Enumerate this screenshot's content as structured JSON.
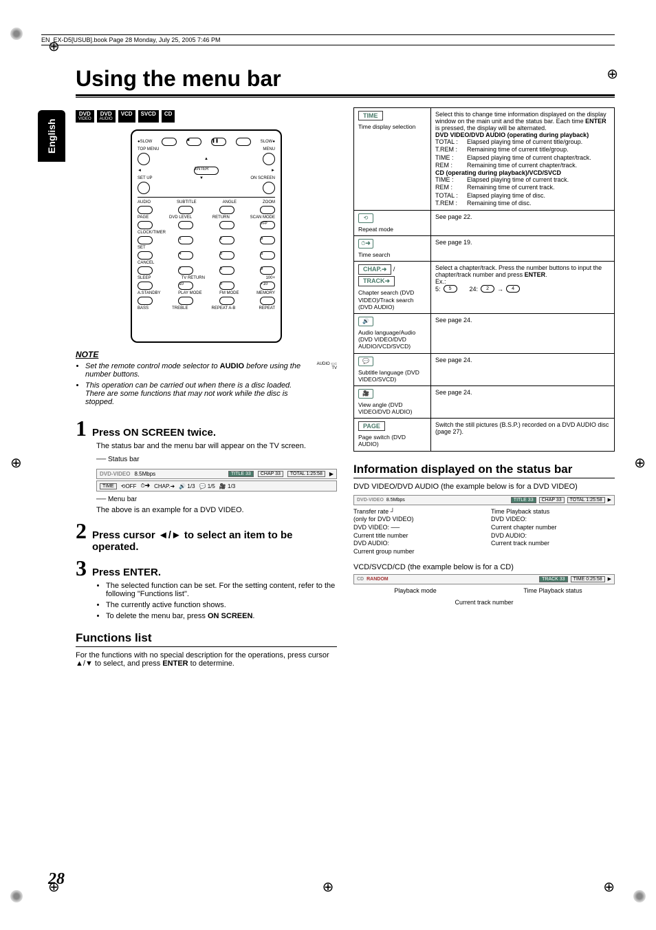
{
  "header": "EN_EX-D5[USUB].book  Page 28  Monday, July 25, 2005  7:46 PM",
  "side_tab": "English",
  "title": "Using the menu bar",
  "badges": [
    {
      "t": "DVD",
      "s": "VIDEO"
    },
    {
      "t": "DVD",
      "s": "AUDIO"
    },
    {
      "t": "VCD",
      "s": ""
    },
    {
      "t": "SVCD",
      "s": ""
    },
    {
      "t": "CD",
      "s": ""
    }
  ],
  "remote": {
    "labels": [
      "SLOW",
      "TOP MENU",
      "MENU",
      "ENTER",
      "SET UP",
      "ON SCREEN",
      "AUDIO",
      "SUBTITLE",
      "ANGLE",
      "ZOOM",
      "PAGE",
      "DVD LEVEL",
      "RETURN",
      "SCAN MODE",
      "VFP",
      "CLOCK/TIMER",
      "1",
      "2",
      "3",
      "SET",
      "4",
      "5",
      "6",
      "CANCEL",
      "7",
      "8",
      "9",
      "SLEEP",
      "TV RETURN",
      "100+",
      "10",
      "0",
      "+10",
      "A.STANDBY",
      "PLAY MODE",
      "FM MODE",
      "MEMORY",
      "BASS",
      "TREBLE",
      "REPEAT A-B",
      "REPEAT"
    ]
  },
  "note": {
    "head": "NOTE",
    "items": [
      {
        "text": "Set the remote control mode selector to ",
        "bold": "AUDIO",
        "after": " before using the number buttons."
      },
      {
        "text": "This operation can be carried out when there is a disc loaded. There are some functions that may not work while the disc is stopped.",
        "bold": "",
        "after": ""
      }
    ],
    "audiotv": "AUDIO\nTV"
  },
  "steps": {
    "s1": {
      "num": "1",
      "head": "Press ON SCREEN twice.",
      "body": "The status bar and the menu bar will appear on the TV screen."
    },
    "barlabels": {
      "status": "Status bar",
      "menu": "Menu bar"
    },
    "statusbar": {
      "a": "DVD-VIDEO",
      "b": "8.5Mbps",
      "c": "TITLE 33",
      "d": "CHAP 33",
      "e": "TOTAL  1:25:58"
    },
    "menubar": {
      "a": "TIME",
      "b": "OFF",
      "c": "CHAP.",
      "d": "1/3",
      "e": "1/5",
      "f": "1/3"
    },
    "after_bars": "The above is an example for a DVD VIDEO.",
    "s2": {
      "num": "2",
      "head": "Press cursor ◄/► to select an item to be operated."
    },
    "s3": {
      "num": "3",
      "head": "Press ENTER.",
      "items": [
        "The selected function can be set. For the setting content, refer to the following \"Functions list\".",
        "The currently active function shows.",
        "To delete the menu bar, press ON SCREEN."
      ],
      "bold_in_last": "ON SCREEN"
    }
  },
  "functions_list": {
    "head": "Functions list",
    "intro": "For the functions with no special description for the operations, press cursor ▲/▼ to select, and press ENTER to determine.",
    "bold": "ENTER"
  },
  "table": {
    "time": {
      "pill": "TIME",
      "label": "Time display selection",
      "intro": "Select this to change time information displayed on the display window on the main unit and the status bar. Each time ENTER is pressed, the display will be alternated.",
      "bold_intro": "ENTER",
      "sec1_head": "DVD VIDEO/DVD AUDIO (operating during playback)",
      "sec1": [
        {
          "k": "TOTAL :",
          "v": "Elapsed playing time of current title/group."
        },
        {
          "k": "T.REM :",
          "v": "Remaining time of current title/group."
        },
        {
          "k": "TIME :",
          "v": "Elapsed playing time of current chapter/track."
        },
        {
          "k": "REM :",
          "v": "Remaining time of current chapter/track."
        }
      ],
      "sec2_head": "CD (operating during playback)/VCD/SVCD",
      "sec2": [
        {
          "k": "TIME :",
          "v": "Elapsed playing time of current track."
        },
        {
          "k": "REM :",
          "v": "Remaining time of current track."
        },
        {
          "k": "TOTAL :",
          "v": "Elapsed playing time of disc."
        },
        {
          "k": "T.REM :",
          "v": "Remaining time of disc."
        }
      ]
    },
    "repeat": {
      "label": "Repeat mode",
      "v": "See page 22."
    },
    "timesearch": {
      "label": "Time search",
      "v": "See page 19."
    },
    "chap": {
      "pill1": "CHAP.➜",
      "pill2": "TRACK➜",
      "label": "Chapter search (DVD VIDEO)/Track search (DVD AUDIO)",
      "v1": "Select a chapter/track. Press the number buttons to input the chapter/track number and press ENTER.",
      "bold": "ENTER",
      "ex": "Ex.:",
      "ex5": "5:",
      "ex5v": "5",
      "ex24": "24:",
      "ex24a": "2",
      "ex24b": "4"
    },
    "audio": {
      "label": "Audio language/Audio (DVD VIDEO/DVD AUDIO/VCD/SVCD)",
      "v": "See page 24."
    },
    "subtitle": {
      "label": "Subtitle language (DVD VIDEO/SVCD)",
      "v": "See page 24."
    },
    "angle": {
      "label": "View angle (DVD VIDEO/DVD AUDIO)",
      "v": "See page 24."
    },
    "page": {
      "pill": "PAGE",
      "label": "Page switch (DVD AUDIO)",
      "v": "Switch the still pictures (B.S.P.) recorded on a DVD AUDIO disc (page 27)."
    }
  },
  "info_section": {
    "head": "Information displayed on the status bar",
    "dvd_line": "DVD VIDEO/DVD AUDIO (the example below is for a DVD VIDEO)",
    "bar1": {
      "a": "DVD-VIDEO",
      "b": "8.5Mbps",
      "c": "TITLE 33",
      "d": "CHAP 33",
      "e": "TOTAL  1:25:58"
    },
    "annot1_left": [
      "Transfer rate",
      "(only for DVD VIDEO)",
      "DVD VIDEO:",
      "  Current title number",
      "DVD AUDIO:",
      "  Current group number"
    ],
    "annot1_right": [
      "Time   Playback status",
      "DVD VIDEO:",
      "  Current chapter number",
      "DVD AUDIO:",
      "  Current track number"
    ],
    "vcd_line": "VCD/SVCD/CD (the example below is for a CD)",
    "bar2": {
      "a": "CD",
      "b": "RANDOM",
      "c": "TRACK 33",
      "d": "TIME   0:25:58"
    },
    "annot2_left": "Playback mode",
    "annot2_right": "Time   Playback status",
    "annot2_bottom": "Current track number"
  },
  "page_num": "28"
}
